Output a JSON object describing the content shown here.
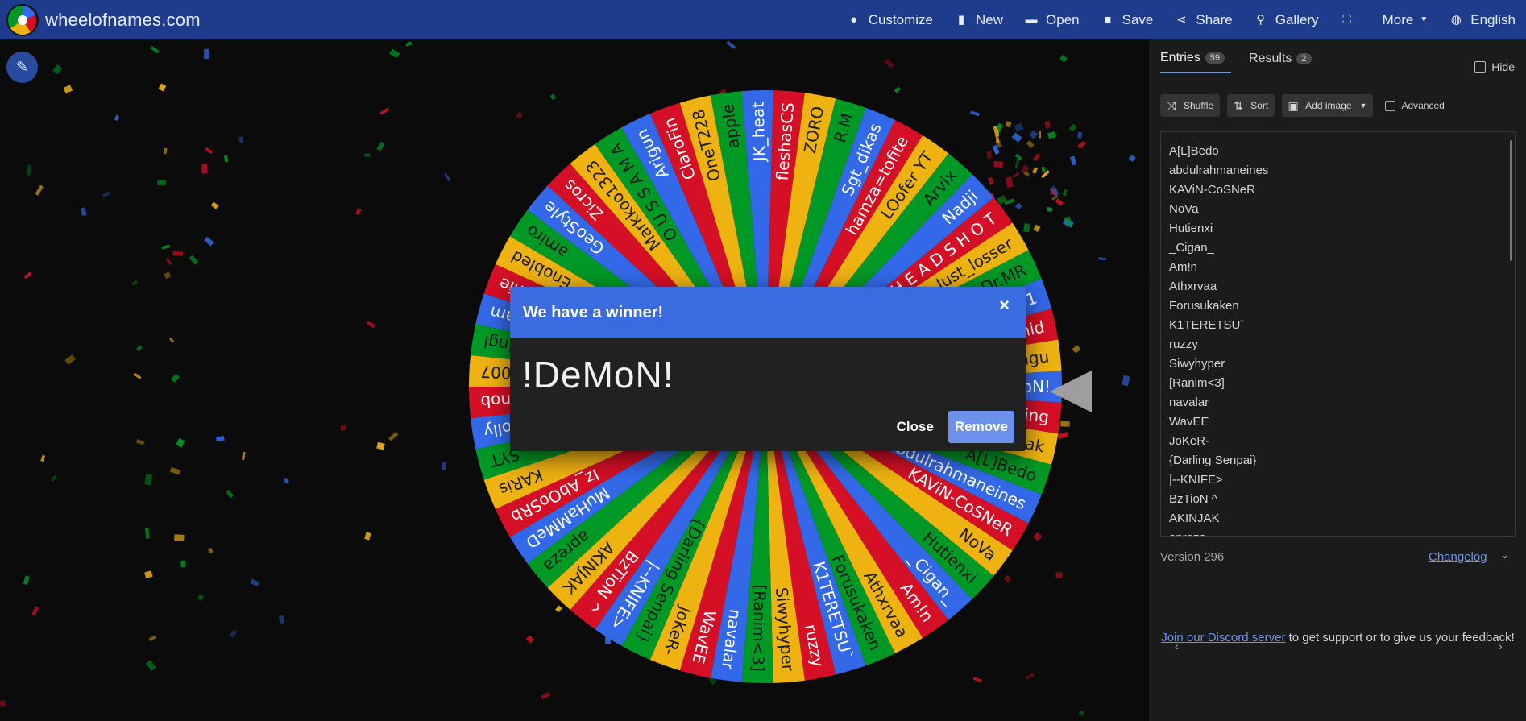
{
  "app": {
    "brand": "wheelofnames.com"
  },
  "menu": [
    {
      "label": "Customize",
      "icon": "palette-icon"
    },
    {
      "label": "New",
      "icon": "file-icon"
    },
    {
      "label": "Open",
      "icon": "folder-icon"
    },
    {
      "label": "Save",
      "icon": "save-icon"
    },
    {
      "label": "Share",
      "icon": "share-icon"
    },
    {
      "label": "Gallery",
      "icon": "search-icon"
    },
    {
      "label": "",
      "icon": "fullscreen-icon"
    },
    {
      "label": "More",
      "icon": "chevron-down-icon"
    },
    {
      "label": "English",
      "icon": "globe-icon"
    }
  ],
  "dialog": {
    "title": "We have a winner!",
    "close_symbol": "×",
    "winner": "!DeMoN!",
    "close_label": "Close",
    "remove_label": "Remove"
  },
  "panel": {
    "tabs": [
      {
        "label": "Entries",
        "count": "59"
      },
      {
        "label": "Results",
        "count": "2"
      }
    ],
    "hide_label": "Hide",
    "toolbar": {
      "shuffle": "Shuffle",
      "sort": "Sort",
      "add_image": "Add image",
      "advanced": "Advanced"
    },
    "entries": [
      "A[L]Bedo",
      "abdulrahmaneines",
      "KAViN-CoSNeR",
      "NoVa",
      "Hutienxi",
      "_Cigan_",
      "Am!n",
      "Athxrvaa",
      "Forusukaken",
      "K1TERETSU`",
      "ruzzy",
      "Siwyhyper",
      "[Ranim<3]",
      "navalar",
      "WavEE",
      "JoKeR-",
      "{Darling Senpai}",
      "|--KNIFE>",
      "BzTioN ^",
      "AKINJAK",
      "apreza"
    ],
    "version": "Version 296",
    "changelog": "Changelog",
    "footer_link": "Join our Discord server",
    "footer_text": " to get support or to give us your feedback!"
  },
  "wheel": {
    "colors": [
      "#3369e8",
      "#d50f25",
      "#eeb211",
      "#009925"
    ],
    "segments": [
      "!DeMoN!",
      "Hacking",
      "Ttdak",
      "A[L]Bedo",
      "abdulrahmaneines",
      "KAViN-CoSNeR",
      "NoVa",
      "Hutienxi",
      "_Cigan_",
      "Am!n",
      "Athxrvaa",
      "Forusukaken",
      "K1TERETSU`",
      "ruzzy",
      "Siwyhyper",
      "[Ranim<3]",
      "navalar",
      "WavEE",
      "JoKeR-",
      "{Darling Senpai}",
      "|--KNIFE>",
      "BzTioN ^",
      "AKINJAK",
      "apreza",
      "MuHaMMeD",
      "Iz_AbOoSRb",
      "KARis",
      "SYT",
      "polly",
      "Knob",
      "007",
      "kingl",
      "MoHam",
      "richie",
      "Enobled",
      "amiro",
      "GeoStyle",
      "Zicros",
      "Markkoo1323",
      "O U S S A M A",
      "Arigun",
      "ClaroFin",
      "OneT228",
      "apple",
      "JK_heat",
      "fleshasCS",
      "ZORO",
      "R.M",
      "Sgt_dikas",
      "hamza=tofite",
      "LOofer YT",
      "Arvix",
      "Nadji",
      "H E A D S H O T",
      "Just_losser",
      "Dr.MR",
      "KSKSKSS.681",
      "Nahid",
      "Ttngu"
    ]
  }
}
